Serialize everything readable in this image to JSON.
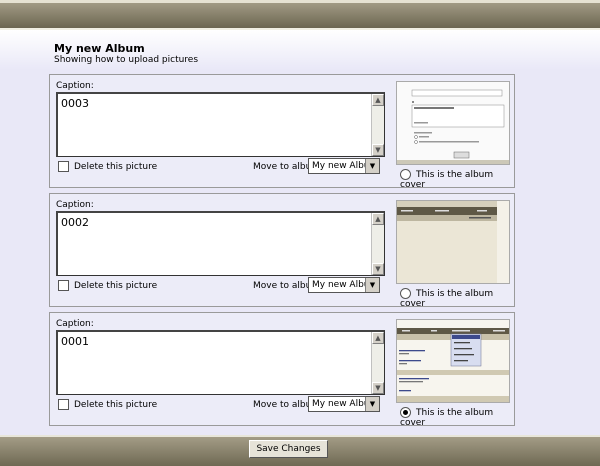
{
  "album": {
    "title": "My new Album",
    "description": "Showing how to upload pictures"
  },
  "labels": {
    "caption": "Caption:",
    "delete": "Delete this picture",
    "move_to": "Move to album:",
    "cover": "This is the album cover"
  },
  "photos": [
    {
      "caption": "0003",
      "move_album": "My new Album",
      "is_cover": false,
      "delete_checked": false,
      "thumb": "album-form-screenshot"
    },
    {
      "caption": "0002",
      "move_album": "My new Album",
      "is_cover": false,
      "delete_checked": false,
      "thumb": "beige-site-screenshot"
    },
    {
      "caption": "0001",
      "move_album": "My new Album",
      "is_cover": true,
      "delete_checked": false,
      "thumb": "menu-dropdown-screenshot"
    }
  ],
  "save_button": "Save Changes",
  "icons": {
    "scroll_up": "scroll-up-arrow-icon",
    "scroll_down": "scroll-down-arrow-icon",
    "dropdown": "chevron-down-icon"
  },
  "colors": {
    "header_bar": "#8a8470",
    "page_bg": "#e9e8f7",
    "box_border": "#9a9a9a"
  }
}
